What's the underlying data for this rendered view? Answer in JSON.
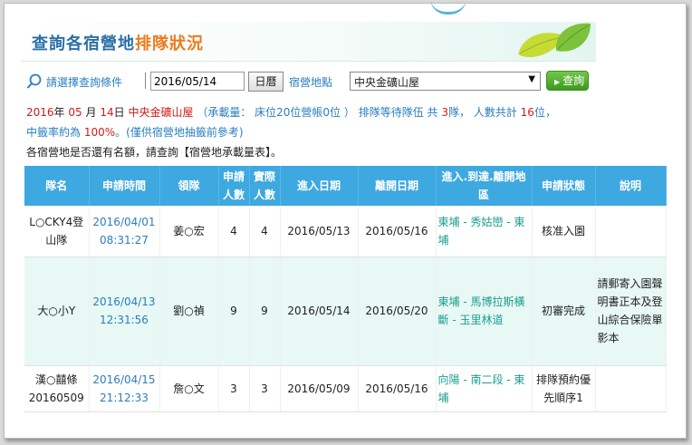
{
  "header": {
    "title_prefix": "查詢各宿營地",
    "title_highlight": "排隊狀況"
  },
  "search": {
    "label": "請選擇查詢條件",
    "date_value": "2016/05/14",
    "calendar_button": "日曆",
    "site_label": "宿營地點",
    "site_selected": "中央金礦山屋",
    "query_button": "查詢"
  },
  "info": {
    "year": "2016",
    "year_unit": "年",
    "month": "05",
    "month_unit": "月",
    "day": "14",
    "day_unit": "日",
    "site": "中央金礦山屋",
    "capacity_text": "（承載量： 床位20位營帳0位 ）",
    "queue_prefix": "排隊等待隊伍 共",
    "queue_count": "3",
    "queue_unit": "隊，",
    "people_prefix": "人數共計",
    "people_count": "16",
    "people_unit": "位，",
    "rate_prefix": "中籤率約為",
    "rate_value": "100%",
    "rate_suffix": "。",
    "rate_note": "(僅供宿營地抽籤前參考)",
    "capacity_line": "各宿營地是否還有名額，請查詢【宿營地承載量表】。"
  },
  "table": {
    "headers": [
      "隊名",
      "申請時間",
      "領隊",
      "申請人數",
      "實際人數",
      "進入日期",
      "離開日期",
      "進入.到達.離開地區",
      "申請狀態",
      "說明"
    ],
    "rows": [
      {
        "team": "L○CKY4登山隊",
        "time_date": "2016/04/01",
        "time_clock": "08:31:27",
        "leader": "姜○宏",
        "applied": "4",
        "actual": "4",
        "enter": "2016/05/13",
        "leave": "2016/05/16",
        "area": "東埔 - 秀姑巒 - 東埔",
        "status": "核准入園",
        "note": ""
      },
      {
        "team": "大○小Y",
        "time_date": "2016/04/13",
        "time_clock": "12:31:56",
        "leader": "劉○禎",
        "applied": "9",
        "actual": "9",
        "enter": "2016/05/14",
        "leave": "2016/05/20",
        "area": "東埔 - 馬博拉斯橫斷 - 玉里林道",
        "status": "初審完成",
        "note": "請郵寄入園聲明書正本及登山綜合保險單影本"
      },
      {
        "team": "漢○囍條20160509",
        "time_date": "2016/04/15",
        "time_clock": "21:12:33",
        "leader": "詹○文",
        "applied": "3",
        "actual": "3",
        "enter": "2016/05/09",
        "leave": "2016/05/16",
        "area": "向陽 - 南二段 - 東埔",
        "status": "排隊預約優先順序1",
        "note": ""
      }
    ]
  },
  "colors": {
    "header_blue": "#3ea8e0",
    "title_blue": "#2b6fa8",
    "title_orange": "#f07a1c",
    "alert_red": "#d21a1a",
    "area_teal": "#1a9e8e",
    "highlight_row": "#e7f8f5",
    "query_green": "#4aa52a"
  }
}
